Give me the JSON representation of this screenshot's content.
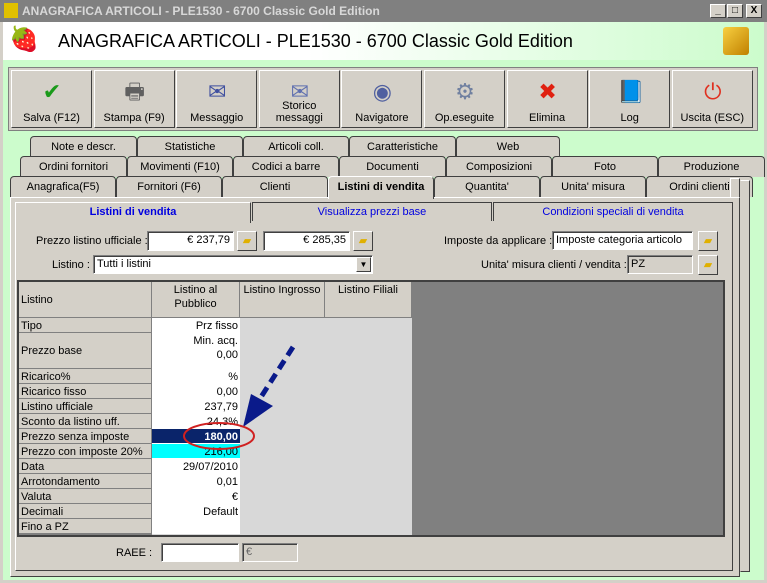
{
  "window": {
    "title": "ANAGRAFICA ARTICOLI - PLE1530 - 6700 Classic Gold Edition",
    "min": "_",
    "max": "□",
    "close": "X"
  },
  "header": {
    "title": "ANAGRAFICA ARTICOLI - PLE1530 - 6700 Classic Gold Edition"
  },
  "toolbar": [
    {
      "label": "Salva (F12)",
      "icon": "check-icon",
      "glyph": "✔",
      "color": "#1a9a1a"
    },
    {
      "label": "Stampa (F9)",
      "icon": "printer-icon",
      "glyph": "🖶",
      "color": "#606060"
    },
    {
      "label": "Messaggio",
      "icon": "envelope-pen-icon",
      "glyph": "✉",
      "color": "#4050a0"
    },
    {
      "label": "Storico messaggi",
      "icon": "envelope-search-icon",
      "glyph": "✉",
      "color": "#6070b0"
    },
    {
      "label": "Navigatore",
      "icon": "compass-icon",
      "glyph": "◉",
      "color": "#5060a0"
    },
    {
      "label": "Op.eseguite",
      "icon": "gears-search-icon",
      "glyph": "⚙",
      "color": "#7080a0"
    },
    {
      "label": "Elimina",
      "icon": "red-x-icon",
      "glyph": "✖",
      "color": "#e02010"
    },
    {
      "label": "Log",
      "icon": "book-search-icon",
      "glyph": "📘",
      "color": "#2050c0"
    },
    {
      "label": "Uscita (ESC)",
      "icon": "power-icon",
      "glyph": "⏻",
      "color": "#e03020"
    }
  ],
  "tabs": {
    "row1": [
      "Note e descr.",
      "Statistiche",
      "Articoli coll.",
      "Caratteristiche",
      "Web"
    ],
    "row2": [
      "Ordini fornitori",
      "Movimenti (F10)",
      "Codici a barre",
      "Documenti",
      "Composizioni",
      "Foto",
      "Produzione"
    ],
    "row3": [
      "Anagrafica(F5)",
      "Fornitori (F6)",
      "Clienti",
      "Listini di vendita",
      "Quantita'",
      "Unita' misura",
      "Ordini clienti"
    ],
    "active": "Listini di vendita"
  },
  "subtabs": [
    "Listini di vendita",
    "Visualizza prezzi base",
    "Condizioni speciali di vendita"
  ],
  "form": {
    "prezzo_label": "Prezzo listino ufficiale :",
    "prezzo1": "€ 237,79",
    "prezzo2": "€ 285,35",
    "listino_label": "Listino :",
    "listino_value": "Tutti i listini",
    "imposte_label": "Imposte da applicare :",
    "imposte_value": "Imposte categoria articolo",
    "um_label": "Unita' misura clienti / vendita :",
    "um_value": "PZ",
    "raee_label": "RAEE :",
    "raee_value": "",
    "raee_currency": "€"
  },
  "grid": {
    "headers": [
      "Listino",
      "Listino al Pubblico",
      "Listino Ingrosso",
      "Listino Filiali"
    ],
    "rows": [
      {
        "label": "Tipo",
        "value": "Prz fisso"
      },
      {
        "label": "Prezzo base",
        "value": "Min. acq.\n0,00"
      },
      {
        "label": "Ricarico%",
        "value": "%"
      },
      {
        "label": "Ricarico fisso",
        "value": "0,00"
      },
      {
        "label": "Listino ufficiale",
        "value": "237,79"
      },
      {
        "label": "Sconto da listino uff.",
        "value": "24,3%"
      },
      {
        "label": "Prezzo senza imposte",
        "value": "180,00"
      },
      {
        "label": "Prezzo con imposte 20%",
        "value": "216,00"
      },
      {
        "label": "Data",
        "value": "29/07/2010"
      },
      {
        "label": "Arrotondamento",
        "value": "0,01"
      },
      {
        "label": "Valuta",
        "value": "€"
      },
      {
        "label": "Decimali",
        "value": "Default"
      },
      {
        "label": "Fino a PZ",
        "value": ""
      }
    ],
    "selected_color": "#0a246a",
    "highlight_color": "#00ffff"
  }
}
